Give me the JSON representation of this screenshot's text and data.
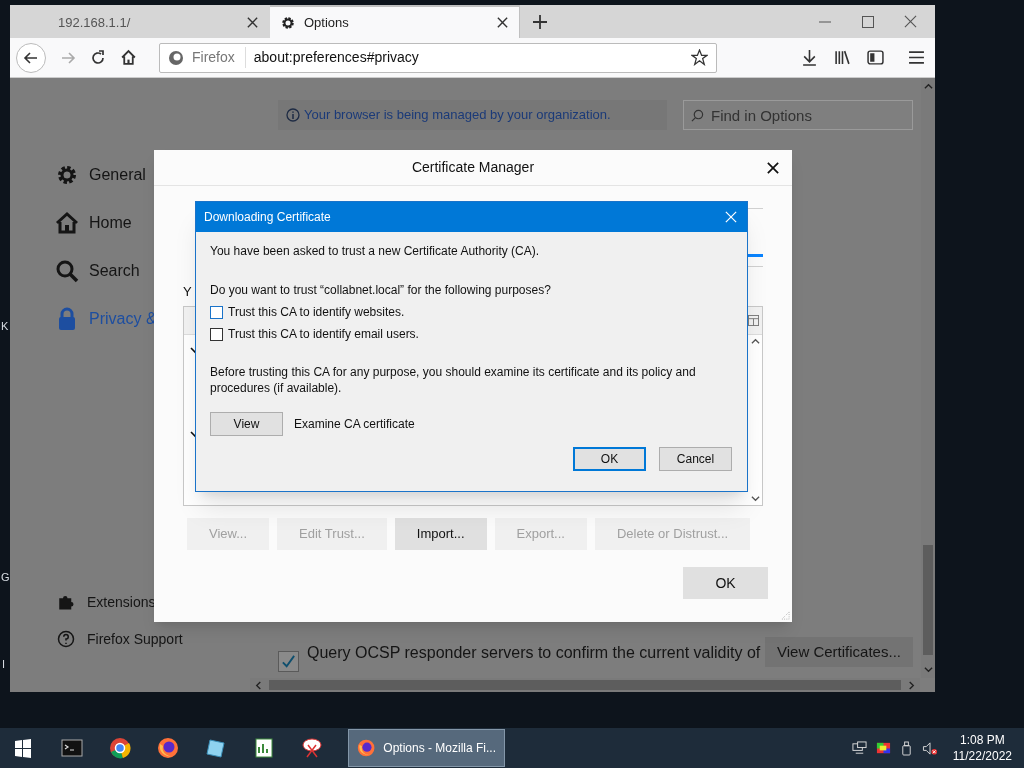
{
  "desktop_labels": [
    "K",
    "G",
    "I"
  ],
  "tabs": [
    {
      "label": "192.168.1.1/",
      "selected": false
    },
    {
      "label": "Options",
      "selected": true
    }
  ],
  "address_bar": {
    "identity": "Firefox",
    "url": "about:preferences#privacy"
  },
  "preferences": {
    "notice": "Your browser is being managed by your organization.",
    "search": {
      "placeholder": "Find in Options"
    },
    "sidebar": {
      "items": [
        {
          "label": "General",
          "selected": false
        },
        {
          "label": "Home",
          "selected": false
        },
        {
          "label": "Search",
          "selected": false
        },
        {
          "label": "Privacy &",
          "selected": true
        }
      ],
      "footer": [
        "Extensions",
        "Firefox Support"
      ]
    },
    "ocsp": {
      "label": "Query OCSP responder servers to confirm the current validity of",
      "checked": true
    },
    "view_certificates": "View Certificates..."
  },
  "certificate_manager": {
    "title": "Certificate Manager",
    "partial_text": "Y",
    "buttons": [
      {
        "label": "View...",
        "disabled": true
      },
      {
        "label": "Edit Trust...",
        "disabled": true
      },
      {
        "label": "Import...",
        "disabled": false
      },
      {
        "label": "Export...",
        "disabled": true
      },
      {
        "label": "Delete or Distrust...",
        "disabled": true
      }
    ],
    "ok": "OK"
  },
  "download_dialog": {
    "title": "Downloading Certificate",
    "intro": "You have been asked to trust a new Certificate Authority (CA).",
    "question": "Do you want to trust “collabnet.local” for the following purposes?",
    "options": [
      {
        "label": "Trust this CA to identify websites.",
        "checked": false
      },
      {
        "label": "Trust this CA to identify email users.",
        "checked": false
      }
    ],
    "advice": "Before trusting this CA for any purpose, you should examine its certificate and its policy and procedures (if available).",
    "view_button": "View",
    "view_label": "Examine CA certificate",
    "buttons": [
      {
        "label": "OK",
        "selected": true
      },
      {
        "label": "Cancel",
        "selected": false
      }
    ]
  },
  "taskbar": {
    "active_window": "Options - Mozilla Fi...",
    "time": "1:08 PM",
    "date": "11/22/2022"
  }
}
